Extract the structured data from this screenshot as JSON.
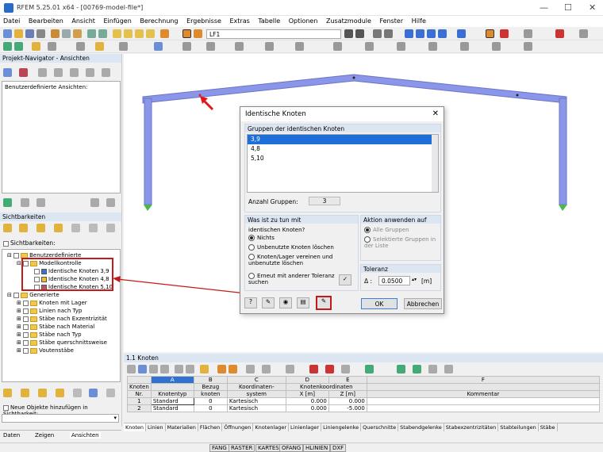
{
  "app": {
    "title": "RFEM 5.25.01 x64 - [00769-model-file*]"
  },
  "menu": [
    "Datei",
    "Bearbeiten",
    "Ansicht",
    "Einfügen",
    "Berechnung",
    "Ergebnisse",
    "Extras",
    "Tabelle",
    "Optionen",
    "Zusatzmodule",
    "Fenster",
    "Hilfe"
  ],
  "toolbar": {
    "loadcase": "LF1"
  },
  "navigator": {
    "title": "Projekt-Navigator - Ansichten",
    "custom_views_label": "Benutzerdefinierte Ansichten:",
    "visibilities_title": "Sichtbarkeiten",
    "visibilities_check": "Sichtbarkeiten:",
    "tree": {
      "custom": "Benutzerdefinierte",
      "model_check": "Modellkontrolle",
      "items": [
        "Identische Knoten 3,9",
        "Identische Knoten 4,8",
        "Identische Knoten 5,10"
      ],
      "item_colors": [
        "#3b6fd4",
        "#e8c22a",
        "#b0566e"
      ],
      "generated": "Generierte",
      "gen_items": [
        "Knoten mit Lager",
        "Linien nach Typ",
        "Stäbe nach Exzentrizität",
        "Stäbe nach Material",
        "Stäbe nach Typ",
        "Stäbe querschnittsweise",
        "Voutenstäbe"
      ]
    },
    "new_objects_label": "Neue Objekte hinzufügen in Sichtbarkeit:",
    "bottom_tabs": [
      "Daten",
      "Zeigen",
      "Ansichten"
    ]
  },
  "dialog": {
    "title": "Identische Knoten",
    "groups_header": "Gruppen der identischen Knoten",
    "groups": [
      "3,9",
      "4,8",
      "5,10"
    ],
    "count_label": "Anzahl Gruppen:",
    "count_value": "3",
    "todo_header": "Was ist zu tun mit",
    "todo_sub": "identischen Knoten?",
    "options": [
      "Nichts",
      "Unbenutzte Knoten löschen",
      "Knoten/Lager vereinen und unbenutzte löschen",
      "Erneut mit anderer Toleranz suchen"
    ],
    "apply_header": "Aktion anwenden auf",
    "apply_options": [
      "Alle Gruppen",
      "Selektierte Gruppen in der Liste"
    ],
    "tolerance_header": "Toleranz",
    "tolerance_symbol": "Δ :",
    "tolerance_value": "0.0500",
    "tolerance_unit": "[m]",
    "ok": "OK",
    "cancel": "Abbrechen"
  },
  "table": {
    "title": "1.1 Knoten",
    "col_letters": [
      "A",
      "B",
      "C",
      "D",
      "E",
      "F"
    ],
    "headers1": [
      "Knoten",
      "",
      "Bezug",
      "Koordinaten-",
      "Knotenkoordinaten",
      "",
      ""
    ],
    "headers2": [
      "Nr.",
      "Knotentyp",
      "knoten",
      "system",
      "X [m]",
      "Z [m]",
      "Kommentar"
    ],
    "rows": [
      [
        "1",
        "Standard",
        "0",
        "Kartesisch",
        "0.000",
        "0.000",
        ""
      ],
      [
        "2",
        "Standard",
        "0",
        "Kartesisch",
        "0.000",
        "-5.000",
        ""
      ]
    ],
    "tabs": [
      "Knoten",
      "Linien",
      "Materialien",
      "Flächen",
      "Öffnungen",
      "Knotenlager",
      "Linienlager",
      "Liniengelenke",
      "Querschnitte",
      "Stabendgelenke",
      "Stabexzentrizitäten",
      "Stabteilungen",
      "Stäbe"
    ]
  },
  "statusbar": [
    "FANG",
    "RASTER",
    "KARTES",
    "OFANG",
    "HLINIEN",
    "DXF"
  ]
}
